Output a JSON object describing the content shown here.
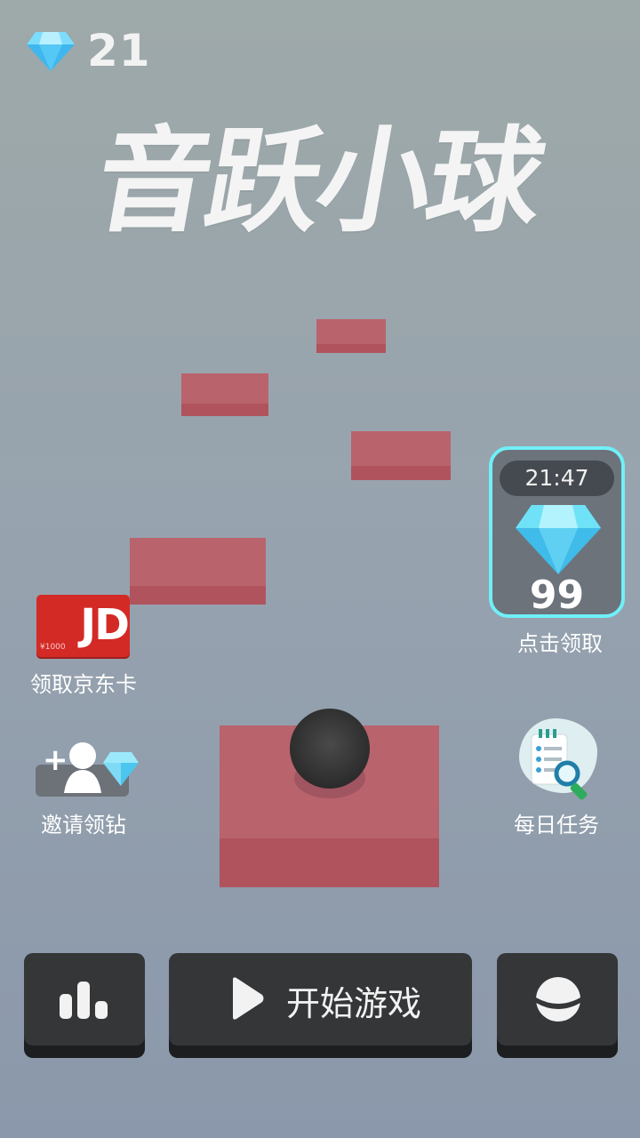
{
  "hud": {
    "diamond_count": "21",
    "icon": "diamond-icon"
  },
  "title": "音跃小球",
  "reward": {
    "timer": "21:47",
    "amount": "99",
    "label": "点击领取"
  },
  "side_items": {
    "jd_card_label": "领取京东卡",
    "jd_card_text": "JD",
    "jd_card_value": "¥1000",
    "invite_label": "邀请领钻",
    "daily_task_label": "每日任务"
  },
  "buttons": {
    "leaderboard_icon": "bar-chart-icon",
    "start_label": "开始游戏",
    "skin_icon": "ball-skin-icon"
  },
  "colors": {
    "platform_top": "#b9636c",
    "platform_side": "#b0535d",
    "accent_cyan": "#6ff0f6",
    "button_bg": "#343638"
  }
}
